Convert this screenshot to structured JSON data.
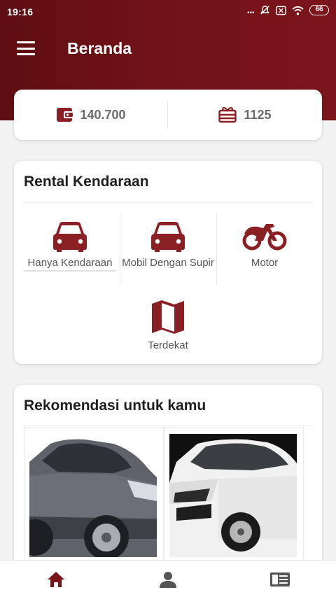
{
  "status_bar": {
    "time": "19:16",
    "dots": "...",
    "battery": "66"
  },
  "header": {
    "title": "Beranda"
  },
  "balance": {
    "wallet_amount": "140.700",
    "points": "1125"
  },
  "rental": {
    "title": "Rental Kendaraan",
    "options": [
      {
        "label": "Hanya Kendaraan",
        "icon": "car-icon"
      },
      {
        "label": "Mobil Dengan Supir",
        "icon": "car-icon"
      },
      {
        "label": "Motor",
        "icon": "motorcycle-icon"
      },
      {
        "label": "Terdekat",
        "icon": "map-icon"
      }
    ]
  },
  "recommendations": {
    "title": "Rekomendasi untuk kamu"
  },
  "bottom_nav": [
    "home-icon",
    "profile-icon",
    "news-icon"
  ],
  "colors": {
    "primary": "#7a151b",
    "icon": "#8a1f24",
    "text": "#1f1f1f"
  }
}
